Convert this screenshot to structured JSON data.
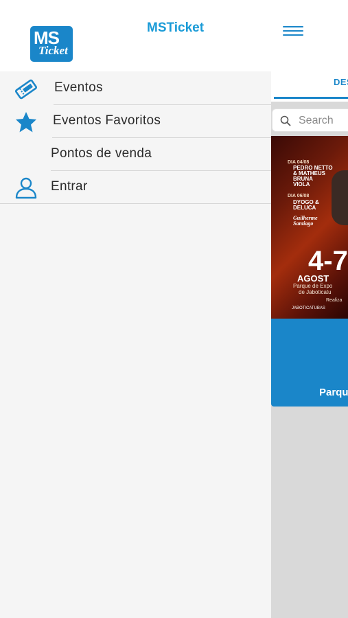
{
  "drawer": {
    "app_title": "MSTicket",
    "logo_text_top": "MS",
    "logo_text_bottom": "Ticket",
    "items": [
      {
        "label": "Eventos",
        "icon": "ticket-icon"
      },
      {
        "label": "Eventos Favoritos",
        "icon": "star-icon"
      },
      {
        "label": "Pontos de venda",
        "icon": ""
      },
      {
        "label": "Entrar",
        "icon": "user-icon"
      }
    ]
  },
  "main": {
    "menu_icon": "hamburger-icon",
    "tab_label": "DES",
    "search_placeholder": "Search",
    "poster": {
      "line1": "DIA 04/08",
      "artist1": "PEDRO NETTO & MATHEUS",
      "artist2": "BRUNA VIOLA",
      "line2": "DIA 06/08",
      "artist3": "DYOGO & DELUCA",
      "artist4": "Guilherme Santiago",
      "big_date": "4-7",
      "month": "AGOST",
      "place_line1": "Parque de Expo",
      "place_line2": "de Jaboticatu",
      "realiza": "Realiza",
      "sponsor": "JABOTICATUBAS"
    },
    "card_place": "Parqu"
  },
  "colors": {
    "brand": "#1a86c9",
    "title": "#1a9bd7",
    "drawer_bg": "#f5f5f5"
  }
}
